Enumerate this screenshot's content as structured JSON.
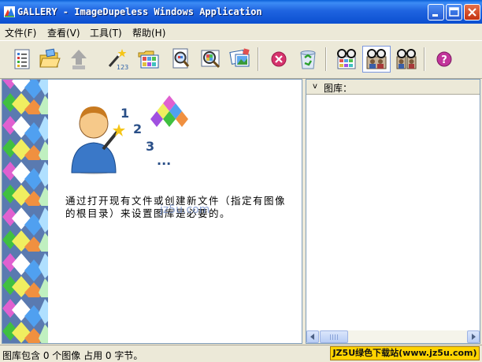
{
  "window": {
    "title": "GALLERY - ImageDupeless Windows Application"
  },
  "menu": {
    "items": [
      {
        "label": "文件(F)"
      },
      {
        "label": "查看(V)"
      },
      {
        "label": "工具(T)"
      },
      {
        "label": "帮助(H)"
      }
    ]
  },
  "toolbar": {
    "buttons": [
      {
        "icon": "properties-icon",
        "enabled": true
      },
      {
        "icon": "open-folder-icon",
        "enabled": true
      },
      {
        "icon": "up-arrow-icon",
        "enabled": false
      },
      {
        "icon": "magic-wand-123-icon",
        "enabled": true
      },
      {
        "icon": "folder-gallery-icon",
        "enabled": true
      },
      {
        "icon": "zoom-document-icon",
        "enabled": true
      },
      {
        "icon": "zoom-grid-icon",
        "enabled": true
      },
      {
        "icon": "gallery-photos-icon",
        "enabled": true
      },
      {
        "icon": "stop-icon",
        "enabled": true
      },
      {
        "icon": "recycle-bin-icon",
        "enabled": true
      },
      {
        "icon": "glasses-grid-icon",
        "enabled": true
      },
      {
        "icon": "glasses-people-icon",
        "enabled": true,
        "pressed": true
      },
      {
        "icon": "glasses-people-pair-icon",
        "enabled": true
      },
      {
        "icon": "help-icon",
        "enabled": true
      }
    ]
  },
  "main": {
    "hint_text": "通过打开现有文件或创建新文件（指定有图像的根目录）来设置图库是必要的。",
    "watermark": "jz5u.com"
  },
  "gallery_panel": {
    "chevron": "v",
    "label": "图库："
  },
  "status": {
    "text": "图库包含 0 个图像 占用 0 字节。",
    "badge": "JZ5U绿色下载站(www.jz5u.com)"
  },
  "colors": {
    "titlebar": "#0b4fd0",
    "chrome": "#ece9d8",
    "pane_border": "#7f9db9",
    "badge": "#ffd400"
  }
}
